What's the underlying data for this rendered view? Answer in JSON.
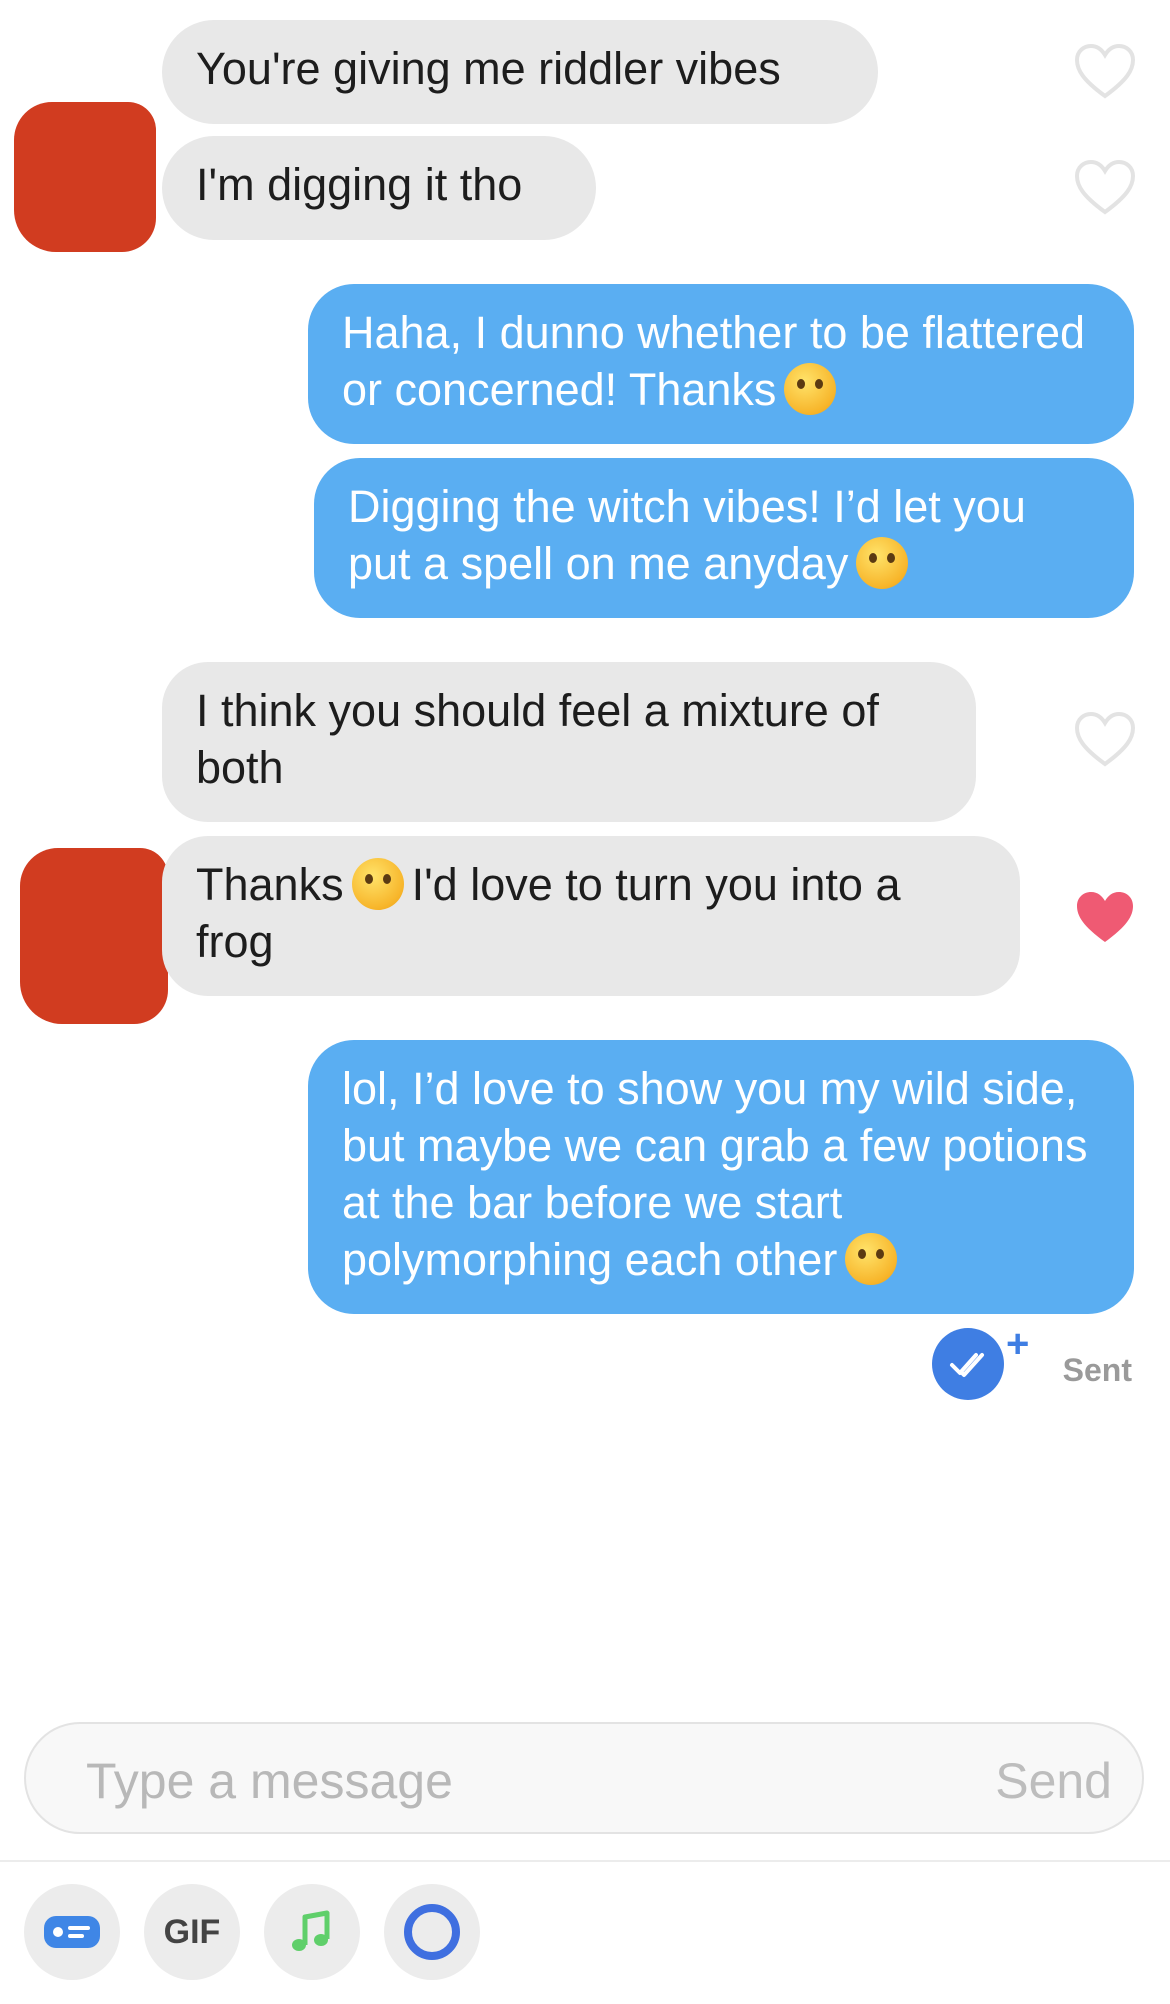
{
  "messages": [
    {
      "text": "You're giving me riddler vibes",
      "liked": false
    },
    {
      "text": "I'm digging it tho",
      "liked": false
    },
    {
      "text_a": "Haha, I dunno whether to be flattered or concerned! Thanks",
      "emoji": "winking-tongue-emoji"
    },
    {
      "text_a": "Digging the witch vibes! I’d let you put a spell on me anyday",
      "emoji": "kissing-heart-emoji"
    },
    {
      "text": "I think you should feel a mixture of both",
      "liked": false
    },
    {
      "text_a": "Thanks",
      "text_b": "I'd love to turn you into a frog",
      "emoji": "smiling-hearts-emoji",
      "liked": true
    },
    {
      "text_a": "lol, I’d love to show you my wild side, but maybe we can grab a few potions at the bar before we start polymorphing each other",
      "emoji": "wink-emoji"
    }
  ],
  "status": {
    "label": "Sent",
    "plus": "+"
  },
  "composer": {
    "placeholder": "Type a message",
    "send_label": "Send"
  },
  "toolbar": {
    "gif_label": "GIF"
  },
  "colors": {
    "sent_bubble": "#5aaef2",
    "received_bubble": "#e8e8e8",
    "like": "#ef5a73",
    "accent": "#3f7ee3"
  }
}
